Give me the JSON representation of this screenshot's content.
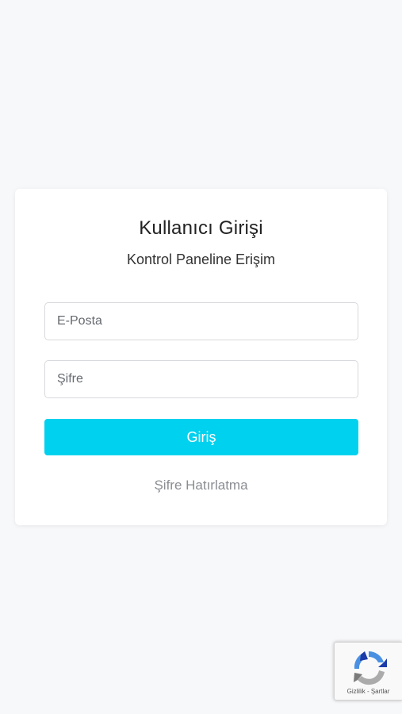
{
  "login": {
    "title": "Kullanıcı Girişi",
    "subtitle": "Kontrol Paneline Erişim",
    "email_placeholder": "E-Posta",
    "password_placeholder": "Şifre",
    "submit_label": "Giriş",
    "forgot_label": "Şifre Hatırlatma"
  },
  "recaptcha": {
    "privacy_label": "Gizlilik",
    "separator": " - ",
    "terms_label": "Şartlar"
  },
  "colors": {
    "accent": "#00d1ef",
    "background": "#f7f8fa",
    "card": "#ffffff"
  },
  "icons": {
    "recaptcha": "recaptcha-icon"
  }
}
